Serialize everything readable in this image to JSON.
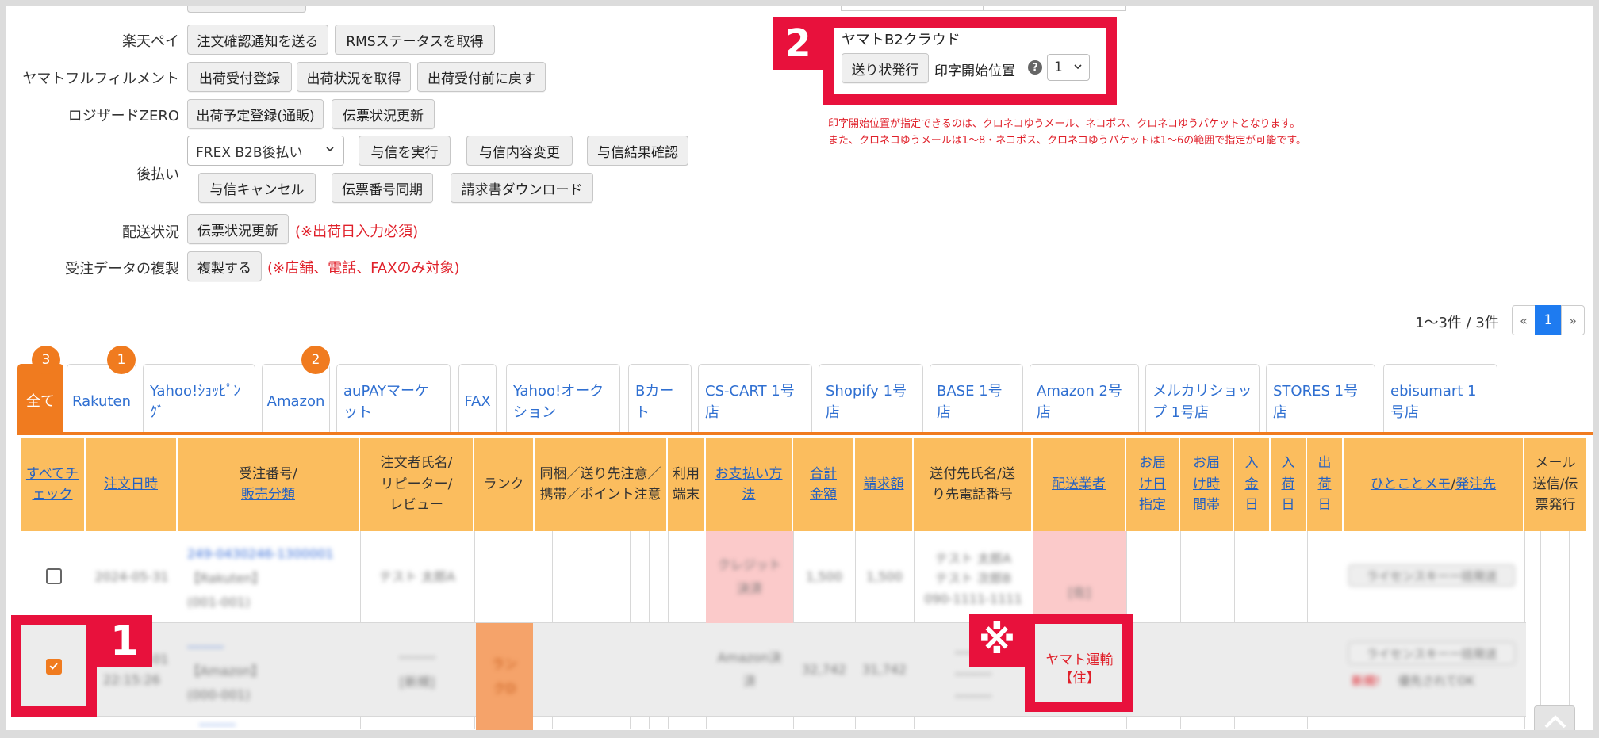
{
  "settings": {
    "rakuten_pay": {
      "label": "楽天ペイ",
      "btn1": "注文確認通知を送る",
      "btn2": "RMSステータスを取得"
    },
    "yamato_fulfillment": {
      "label": "ヤマトフルフィルメント",
      "btn1": "出荷受付登録",
      "btn2": "出荷状況を取得",
      "btn3": "出荷受付前に戻す"
    },
    "logizard": {
      "label": "ロジザードZERO",
      "btn1": "出荷予定登録(通販)",
      "btn2": "伝票状況更新"
    },
    "atobarai": {
      "label": "後払い",
      "select_value": "FREX B2B後払い",
      "btn1": "与信を実行",
      "btn2": "与信内容変更",
      "btn3": "与信結果確認",
      "btn4": "与信キャンセル",
      "btn5": "伝票番号同期",
      "btn6": "請求書ダウンロード"
    },
    "delivery_status": {
      "label": "配送状況",
      "btn": "伝票状況更新",
      "note": "(※出荷日入力必須)"
    },
    "duplicate": {
      "label": "受注データの複製",
      "btn": "複製する",
      "note": "(※店舗、電話、FAXのみ対象)"
    }
  },
  "b2cloud": {
    "title": "ヤマトB2クラウド",
    "issue_btn": "送り状発行",
    "print_pos_label": "印字開始位置",
    "print_pos_value": "1",
    "note1": "印字開始位置が指定できるのは、クロネコゆうメール、ネコポス、クロネコゆうパケットとなります。",
    "note2": "また、クロネコゆうメールは1〜8・ネコポス、クロネコゆうパケットは1〜6の範囲で指定が可能です。"
  },
  "callouts": {
    "one": "1",
    "two": "2",
    "note_mark": "※"
  },
  "pagination": {
    "summary": "1〜3件 / 3件",
    "prev": "«",
    "current": "1",
    "next": "»"
  },
  "tabs": [
    {
      "label": "全て",
      "badge": "3"
    },
    {
      "label": "Rakuten",
      "badge": "1"
    },
    {
      "label": "Yahoo!ｼｮｯﾋﾟﾝｸﾞ"
    },
    {
      "label": "Amazon",
      "badge": "2"
    },
    {
      "label": "auPAYマーケット"
    },
    {
      "label": "FAX"
    },
    {
      "label": "Yahoo!オークション"
    },
    {
      "label": "Bカート"
    },
    {
      "label": "CS-CART 1号店"
    },
    {
      "label": "Shopify 1号店"
    },
    {
      "label": "BASE 1号店"
    },
    {
      "label": "Amazon 2号店"
    },
    {
      "label": "メルカリショップ 1号店"
    },
    {
      "label": "STORES 1号店"
    },
    {
      "label": "ebisumart 1号店"
    }
  ],
  "columns": {
    "check_all": "すべてチェック",
    "order_date": "注文日時",
    "order_no": "受注番号/",
    "sales_class": "販売分類",
    "customer": "注文者氏名/リピーター/レビュー",
    "rank": "ランク",
    "bundle": "同梱／送り先注意／携帯／ポイント注意",
    "device": "利用端末",
    "payment": "お支払い方法",
    "total": "合計金額",
    "billing": "請求額",
    "recipient": "送付先氏名/送り先電話番号",
    "carrier": "配送業者",
    "delivery_date": "お届け日指定",
    "delivery_time": "お届け時間帯",
    "paid_date": "入金日",
    "arrival_date": "入荷日",
    "ship_date": "出荷日",
    "memo": "ひとことメモ",
    "memo_sep": "/",
    "order_dest": "発注先",
    "mail": "メール送信/伝票発行"
  },
  "rows": [
    {
      "order_no": "249-0430246-1300001",
      "order_date": "2024-05-31",
      "shop": "【Rakuten】",
      "class": "(001-001)",
      "customer": "テスト 太郎A",
      "payment": "クレジット決済",
      "total": "1,500",
      "billing": "1,500",
      "recipient1": "テスト 太郎A",
      "recipient2": "テスト 次郎B",
      "phone": "090-1111-1111",
      "carrier": "[佐]",
      "memo": "ライセンスキー一括発送"
    },
    {
      "order_no": "--------",
      "order_date": "2024-05-01",
      "order_time": "22:15:26",
      "shop": "【Amazon】",
      "class": "(000-001)",
      "customer": "--------",
      "repeater": "[新規]",
      "rank": "ランクD",
      "payment": "Amazon決済",
      "total": "32,742",
      "billing": "31,742",
      "recipient1": "--------",
      "recipient2": "--------",
      "phone": "--------",
      "carrier": "ヤマト運輸【住】",
      "memo": "ライセンスキー一括発送",
      "memo_tag": "新規!",
      "memo_note": "優先されてOK"
    }
  ],
  "colors": {
    "accent": "#f07b1f",
    "header": "#fbbd5e",
    "highlight_red": "#e8113c",
    "link": "#2461c2"
  }
}
